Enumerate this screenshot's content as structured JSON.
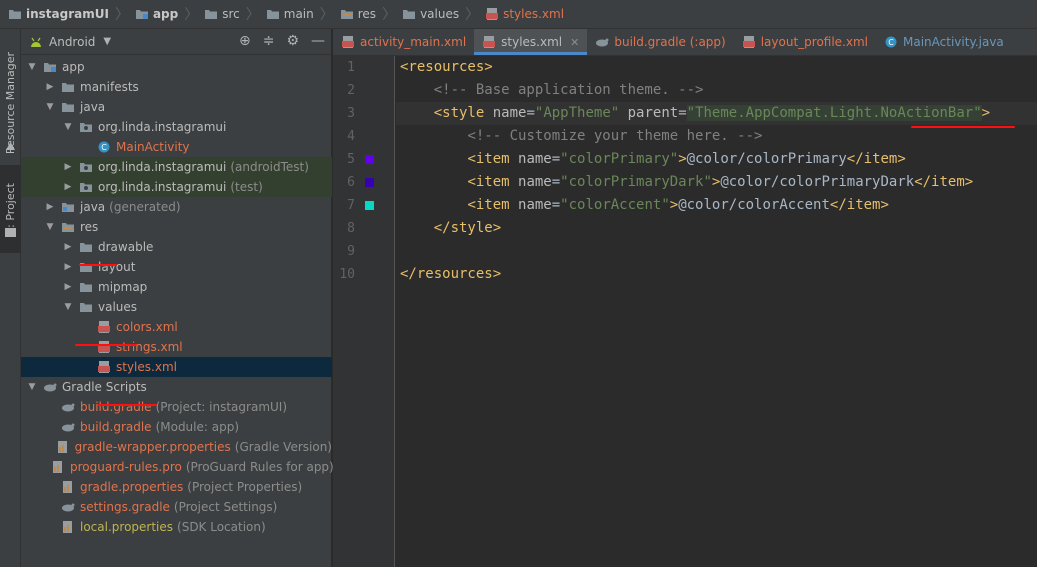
{
  "breadcrumb": [
    {
      "label": "instagramUI",
      "icon": "folder-icon",
      "bold": true
    },
    {
      "label": "app",
      "icon": "module-folder-icon",
      "bold": true
    },
    {
      "label": "src",
      "icon": "folder-icon"
    },
    {
      "label": "main",
      "icon": "folder-icon"
    },
    {
      "label": "res",
      "icon": "resource-folder-icon"
    },
    {
      "label": "values",
      "icon": "folder-icon"
    },
    {
      "label": "styles.xml",
      "icon": "xml-file-icon"
    }
  ],
  "side_tabs": {
    "resource_manager": "Resource Manager",
    "project": "1: Project"
  },
  "project_panel": {
    "view": "Android"
  },
  "tree": [
    {
      "name": "app",
      "extra": "",
      "level": 0,
      "arrow": "down",
      "icon": "module"
    },
    {
      "name": "manifests",
      "extra": "",
      "level": 1,
      "arrow": "right",
      "icon": "folder"
    },
    {
      "name": "java",
      "extra": "",
      "level": 1,
      "arrow": "down",
      "icon": "folder"
    },
    {
      "name": "org.linda.instagramui",
      "extra": "",
      "level": 2,
      "arrow": "down",
      "icon": "package"
    },
    {
      "name": "MainActivity",
      "extra": "",
      "level": 3,
      "arrow": "",
      "icon": "class",
      "color": "red"
    },
    {
      "name": "org.linda.instagramui",
      "extra": "(androidTest)",
      "level": 2,
      "arrow": "right",
      "icon": "package",
      "hl": true
    },
    {
      "name": "org.linda.instagramui",
      "extra": "(test)",
      "level": 2,
      "arrow": "right",
      "icon": "package",
      "hl": true
    },
    {
      "name": "java",
      "extra": "(generated)",
      "level": 1,
      "arrow": "right",
      "icon": "folder-gen"
    },
    {
      "name": "res",
      "extra": "",
      "level": 1,
      "arrow": "down",
      "icon": "res"
    },
    {
      "name": "drawable",
      "extra": "",
      "level": 2,
      "arrow": "right",
      "icon": "folder"
    },
    {
      "name": "layout",
      "extra": "",
      "level": 2,
      "arrow": "right",
      "icon": "folder"
    },
    {
      "name": "mipmap",
      "extra": "",
      "level": 2,
      "arrow": "right",
      "icon": "folder"
    },
    {
      "name": "values",
      "extra": "",
      "level": 2,
      "arrow": "down",
      "icon": "folder"
    },
    {
      "name": "colors.xml",
      "extra": "",
      "level": 3,
      "arrow": "",
      "icon": "xml",
      "color": "red"
    },
    {
      "name": "strings.xml",
      "extra": "",
      "level": 3,
      "arrow": "",
      "icon": "xml",
      "color": "red"
    },
    {
      "name": "styles.xml",
      "extra": "",
      "level": 3,
      "arrow": "",
      "icon": "xml",
      "color": "red",
      "sel": true
    },
    {
      "name": "Gradle Scripts",
      "extra": "",
      "level": 0,
      "arrow": "down",
      "icon": "gradle-scripts"
    },
    {
      "name": "build.gradle",
      "extra": "(Project: instagramUI)",
      "level": 1,
      "arrow": "",
      "icon": "gradle",
      "color": "red"
    },
    {
      "name": "build.gradle",
      "extra": "(Module: app)",
      "level": 1,
      "arrow": "",
      "icon": "gradle",
      "color": "red"
    },
    {
      "name": "gradle-wrapper.properties",
      "extra": "(Gradle Version)",
      "level": 1,
      "arrow": "",
      "icon": "props",
      "color": "red"
    },
    {
      "name": "proguard-rules.pro",
      "extra": "(ProGuard Rules for app)",
      "level": 1,
      "arrow": "",
      "icon": "pro",
      "color": "red"
    },
    {
      "name": "gradle.properties",
      "extra": "(Project Properties)",
      "level": 1,
      "arrow": "",
      "icon": "props",
      "color": "red"
    },
    {
      "name": "settings.gradle",
      "extra": "(Project Settings)",
      "level": 1,
      "arrow": "",
      "icon": "gradle",
      "color": "red"
    },
    {
      "name": "local.properties",
      "extra": "(SDK Location)",
      "level": 1,
      "arrow": "",
      "icon": "props",
      "color": "olive"
    }
  ],
  "editor_tabs": [
    {
      "label": "activity_main.xml",
      "icon": "xml-file-icon"
    },
    {
      "label": "styles.xml",
      "icon": "xml-file-icon",
      "active": true
    },
    {
      "label": "build.gradle (:app)",
      "icon": "gradle-icon"
    },
    {
      "label": "layout_profile.xml",
      "icon": "xml-file-icon"
    },
    {
      "label": "MainActivity.java",
      "icon": "class-icon",
      "java": true
    }
  ],
  "line_numbers": [
    "1",
    "2",
    "3",
    "4",
    "5",
    "6",
    "7",
    "8",
    "9",
    "10"
  ],
  "swatches": [
    {
      "line": 5,
      "color": "#6200ee"
    },
    {
      "line": 6,
      "color": "#3700b3"
    },
    {
      "line": 7,
      "color": "#03dac5"
    }
  ],
  "code_lines": [
    [
      {
        "t": "<resources>",
        "c": "tag"
      }
    ],
    [
      {
        "t": "    "
      },
      {
        "t": "<!-- Base application theme. -->",
        "c": "cmt"
      }
    ],
    [
      {
        "t": "    "
      },
      {
        "t": "<style ",
        "c": "tag"
      },
      {
        "t": "name",
        "c": "attr"
      },
      {
        "t": "=",
        "c": ""
      },
      {
        "t": "\"AppTheme\"",
        "c": "val"
      },
      {
        "t": " "
      },
      {
        "t": "parent",
        "c": "attr"
      },
      {
        "t": "=",
        "c": ""
      },
      {
        "t": "\"Theme.AppCompat.Light.NoActionBar\"",
        "c": "val strhl",
        "caret": true
      },
      {
        "t": ">",
        "c": "tag"
      }
    ],
    [
      {
        "t": "        "
      },
      {
        "t": "<!-- Customize your theme here. -->",
        "c": "cmt"
      }
    ],
    [
      {
        "t": "        "
      },
      {
        "t": "<item ",
        "c": "tag"
      },
      {
        "t": "name",
        "c": "attr"
      },
      {
        "t": "="
      },
      {
        "t": "\"colorPrimary\"",
        "c": "val"
      },
      {
        "t": ">",
        "c": "tag"
      },
      {
        "t": "@color/colorPrimary"
      },
      {
        "t": "</item>",
        "c": "tag"
      }
    ],
    [
      {
        "t": "        "
      },
      {
        "t": "<item ",
        "c": "tag"
      },
      {
        "t": "name",
        "c": "attr"
      },
      {
        "t": "="
      },
      {
        "t": "\"colorPrimaryDark\"",
        "c": "val"
      },
      {
        "t": ">",
        "c": "tag"
      },
      {
        "t": "@color/colorPrimaryDark"
      },
      {
        "t": "</item>",
        "c": "tag"
      }
    ],
    [
      {
        "t": "        "
      },
      {
        "t": "<item ",
        "c": "tag"
      },
      {
        "t": "name",
        "c": "attr"
      },
      {
        "t": "="
      },
      {
        "t": "\"colorAccent\"",
        "c": "val"
      },
      {
        "t": ">",
        "c": "tag"
      },
      {
        "t": "@color/colorAccent"
      },
      {
        "t": "</item>",
        "c": "tag"
      }
    ],
    [
      {
        "t": "    "
      },
      {
        "t": "</style>",
        "c": "tag"
      }
    ],
    [],
    [
      {
        "t": "</resources>",
        "c": "tag"
      }
    ]
  ],
  "current_line": 3,
  "colors": {
    "accent": "#4a88c7",
    "file_red": "#e0734d",
    "annotation": "#ff1010"
  }
}
